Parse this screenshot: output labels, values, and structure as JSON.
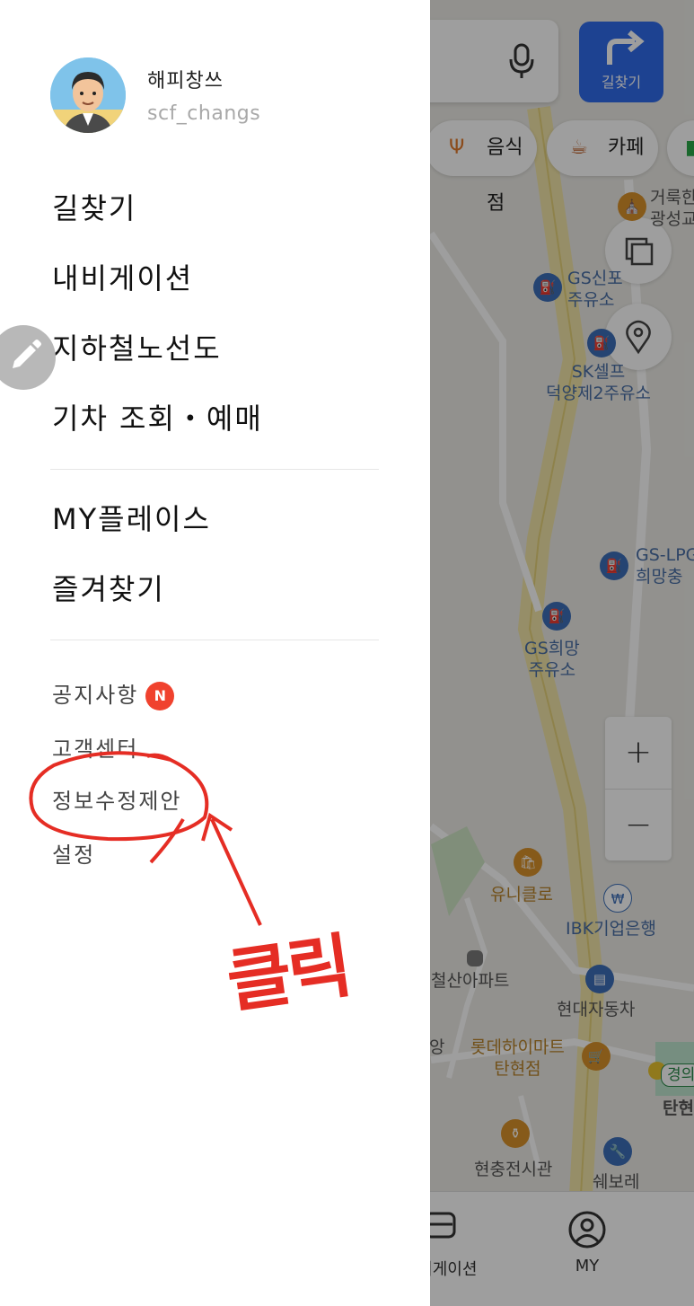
{
  "map": {
    "search_mic_icon": "microphone-icon",
    "route_button_label": "길찾기",
    "categories": [
      {
        "label": "음식점",
        "icon": "fork-knife-icon"
      },
      {
        "label": "카페",
        "icon": "coffee-cup-icon"
      }
    ],
    "pois": {
      "church": "거룩한\n광성교",
      "gs_shinpo": "GS신포\n주유소",
      "sk_self": "SK셀프\n덕양제2주유소",
      "gs_lpg": "GS-LPG\n희망충",
      "gs_huimang": "GS희망\n주유소",
      "uniqlo": "유니클로",
      "ibk": "IBK기업은행",
      "apartment": "철산아파트",
      "hyundai": "현대자동차",
      "lotte": "롯데하이마트\n탄현점",
      "hyunchung": "현충전시관",
      "chevrolet": "쉐보레",
      "partial_left": "앙",
      "station_line": "경의",
      "station_name": "탄현"
    },
    "zoom_in": "+",
    "zoom_out": "−",
    "bottom_nav": [
      {
        "label": "내비게이션",
        "icon": "car-icon"
      },
      {
        "label": "MY",
        "icon": "user-icon"
      }
    ]
  },
  "drawer": {
    "profile": {
      "name": "해피창쓰",
      "id": "scf_changs"
    },
    "main_menu": [
      {
        "label": "길찾기"
      },
      {
        "label": "내비게이션"
      },
      {
        "label": "지하철노선도"
      },
      {
        "label": "기차 조회・예매"
      }
    ],
    "place_menu": [
      {
        "label": "MY플레이스"
      },
      {
        "label": "즐겨찾기"
      }
    ],
    "sub_menu": [
      {
        "label": "공지사항",
        "badge": "N"
      },
      {
        "label": "고객센터"
      },
      {
        "label": "정보수정제안"
      },
      {
        "label": "설정"
      }
    ]
  },
  "annotation": {
    "text": "클릭",
    "color": "#e52d24"
  }
}
